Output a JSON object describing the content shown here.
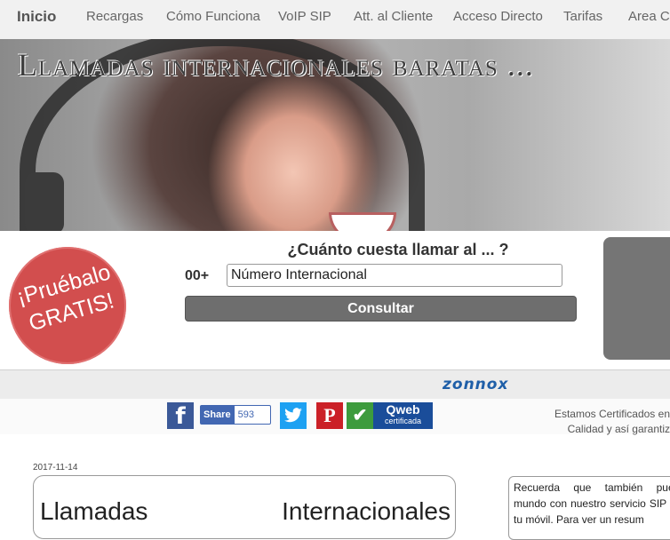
{
  "nav": {
    "home": "Inicio",
    "items": [
      "Recargas",
      "Cómo Funciona",
      "VoIP SIP",
      "Att. al Cliente",
      "Acceso Directo",
      "Tarifas",
      "Area C"
    ]
  },
  "hero": {
    "title": "Llamadas internacionales baratas ..."
  },
  "badge": {
    "line1": "¡Pruébalo",
    "line2": "GRATIS!"
  },
  "calculator": {
    "question": "¿Cuánto cuesta llamar al ... ?",
    "prefix": "00+",
    "number_value": "Número Internacional",
    "button_label": "Consultar"
  },
  "brand": {
    "name": "zonnox"
  },
  "social": {
    "share_label": "Share",
    "share_count": "593",
    "qweb_top": "Qweb",
    "qweb_bottom": "certificada",
    "cert_line1": "Estamos Certificados en",
    "cert_line2": "Calidad y así garantiz"
  },
  "article": {
    "date": "2017-11-14",
    "title": "Llamadas Internacionales",
    "side_text": "Recuerda que también puedes mundo con nuestro servicio SIP para tu móvil. Para ver un resum"
  },
  "icons": {
    "facebook": "facebook-icon",
    "twitter": "twitter-icon",
    "pinterest": "pinterest-icon",
    "check": "check-icon"
  },
  "colors": {
    "badge": "#d24e4e",
    "button": "#6e6e6e",
    "brand": "#1f5fa8",
    "facebook": "#3b5998",
    "twitter": "#1da1f2",
    "pinterest": "#cb2027",
    "qweb": "#1a4d9a"
  }
}
